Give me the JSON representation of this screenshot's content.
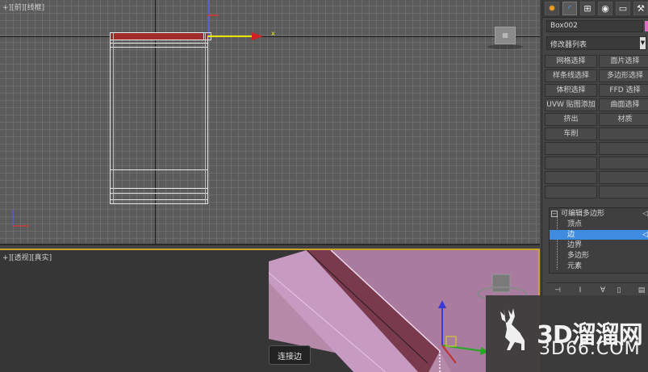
{
  "front_viewport": {
    "label": "+][前][线框]",
    "axis_x_label": "x"
  },
  "persp_viewport": {
    "label": "+][透视][真实]",
    "status_text": "连接边"
  },
  "command_panel": {
    "tab_icons": [
      "create-icon",
      "modify-icon",
      "hierarchy-icon",
      "motion-icon",
      "display-icon",
      "utilities-icon"
    ],
    "object_name": "Box002",
    "object_color": "#e06cc8",
    "modifier_list": "修改器列表",
    "modifier_buttons": [
      [
        "网格选择",
        "面片选择"
      ],
      [
        "样条线选择",
        "多边形选择"
      ],
      [
        "体积选择",
        "FFD 选择"
      ],
      [
        "UVW 贴图添加",
        "曲面选择"
      ],
      [
        "挤出",
        "材质"
      ],
      [
        "车削",
        ""
      ],
      [
        "",
        ""
      ],
      [
        "",
        ""
      ],
      [
        "",
        ""
      ],
      [
        "",
        ""
      ]
    ],
    "stack": {
      "root": "可编辑多边形",
      "items": [
        "顶点",
        "边",
        "边界",
        "多边形",
        "元素"
      ],
      "selected": "边"
    },
    "stack_tools": [
      "pin-stack-icon",
      "show-end-result-icon",
      "make-unique-icon",
      "remove-modifier-icon",
      "configure-sets-icon"
    ]
  },
  "watermark": {
    "title": "3D溜溜网",
    "subtitle": "3D66.COM"
  },
  "colors": {
    "selection_red": "#a02c2c",
    "stack_selected": "#3f8be0",
    "active_viewport_border": "#c9a227",
    "model_pink": "#c79ac2"
  }
}
